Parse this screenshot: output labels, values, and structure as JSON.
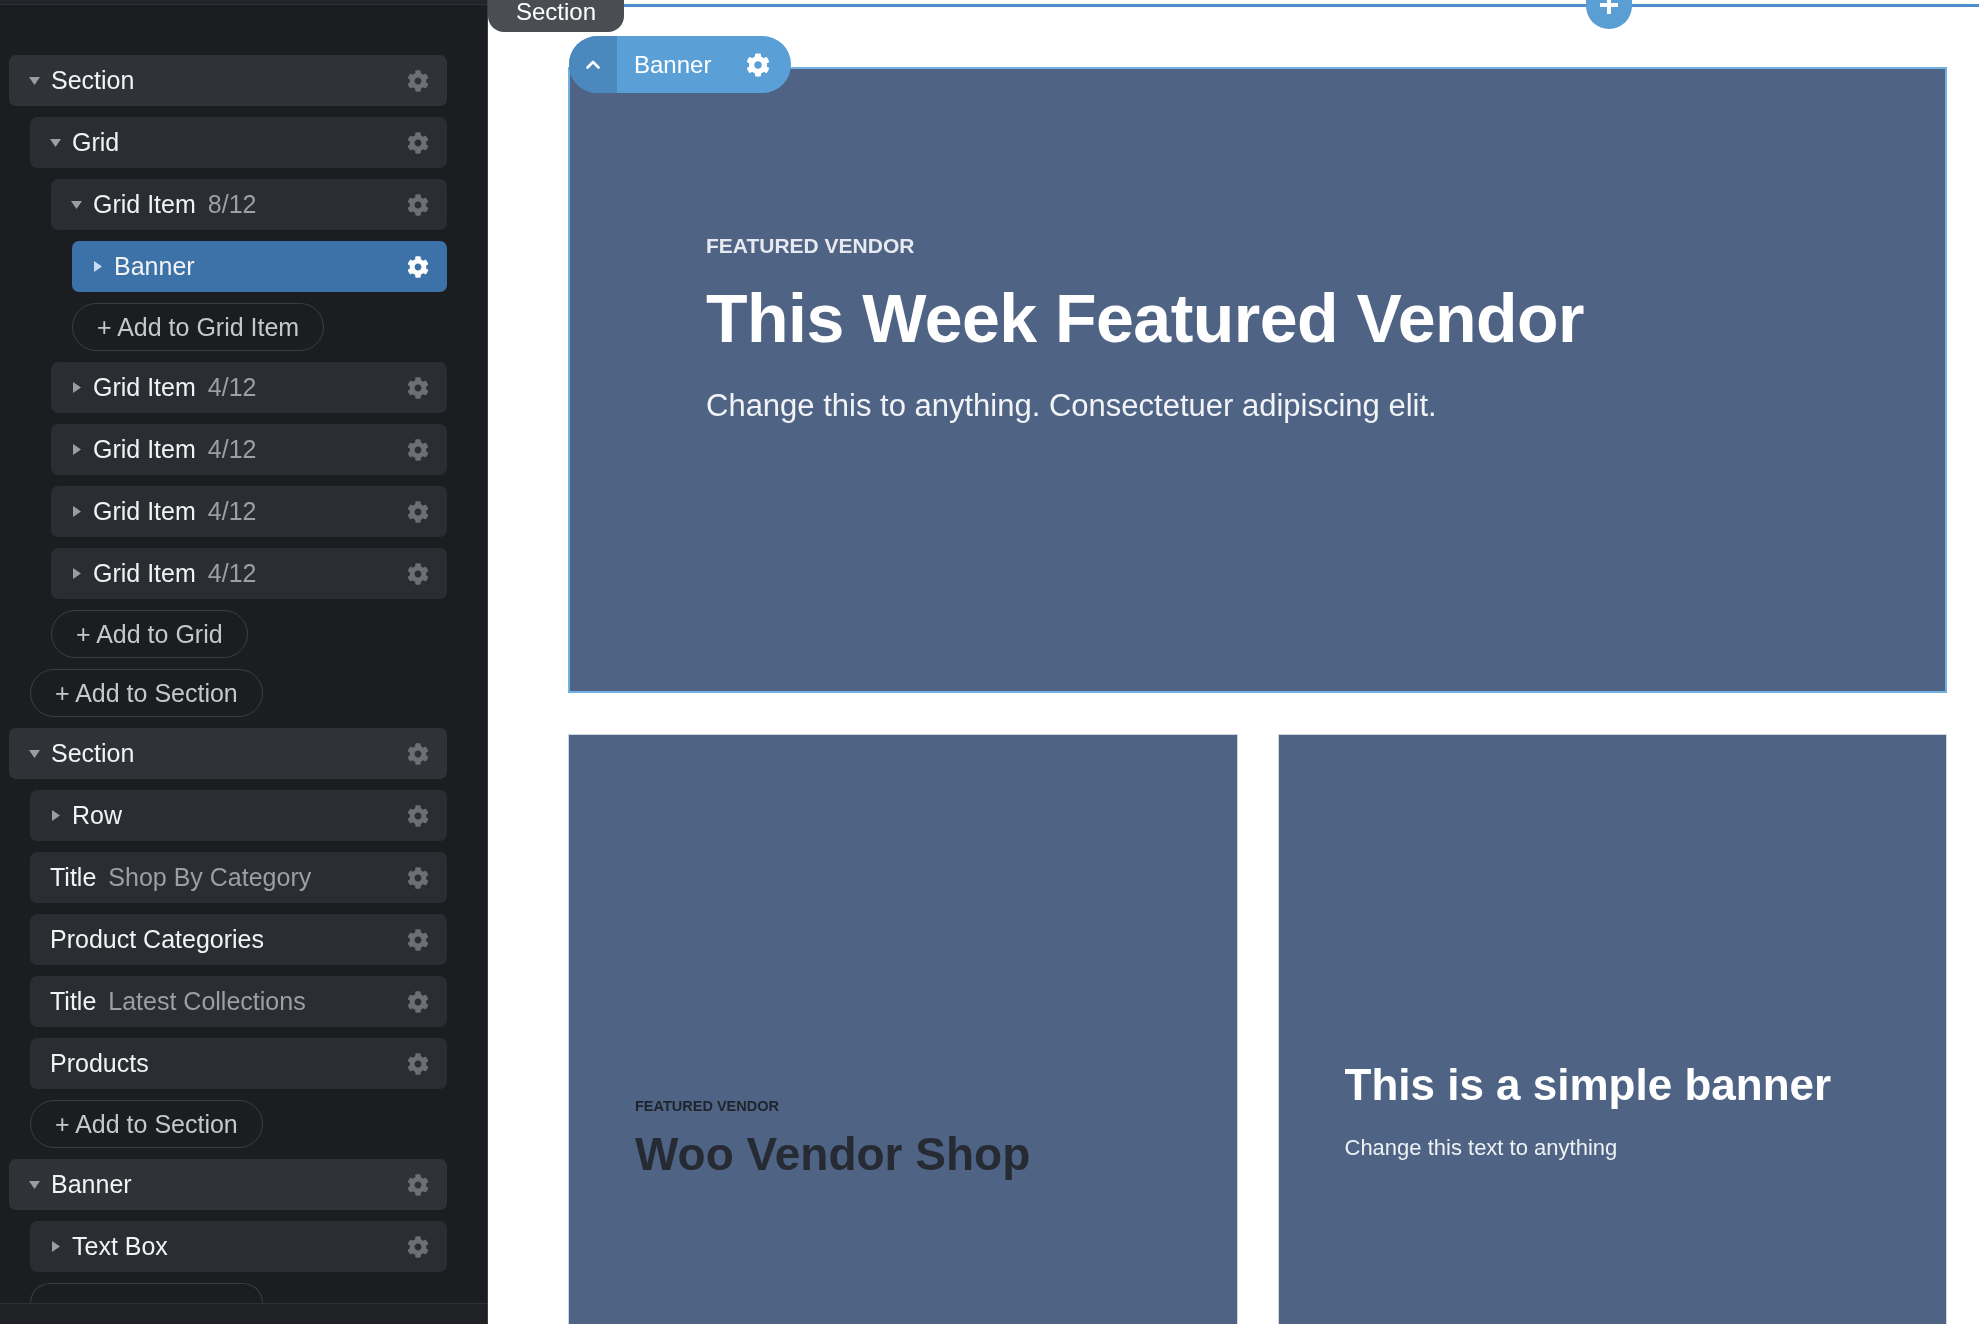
{
  "sidebar": {
    "tree": [
      {
        "kind": "node",
        "label": "Section",
        "expanded": true,
        "selected": false,
        "children": [
          {
            "kind": "node",
            "label": "Grid",
            "expanded": true,
            "selected": false,
            "children": [
              {
                "kind": "node",
                "label": "Grid Item",
                "detail": "8/12",
                "expanded": true,
                "selected": false,
                "children": [
                  {
                    "kind": "node",
                    "label": "Banner",
                    "expanded": false,
                    "selected": true
                  },
                  {
                    "kind": "add",
                    "label": "+ Add to Grid Item"
                  }
                ]
              },
              {
                "kind": "node",
                "label": "Grid Item",
                "detail": "4/12",
                "expanded": false,
                "selected": false
              },
              {
                "kind": "node",
                "label": "Grid Item",
                "detail": "4/12",
                "expanded": false,
                "selected": false
              },
              {
                "kind": "node",
                "label": "Grid Item",
                "detail": "4/12",
                "expanded": false,
                "selected": false
              },
              {
                "kind": "node",
                "label": "Grid Item",
                "detail": "4/12",
                "expanded": false,
                "selected": false
              },
              {
                "kind": "add",
                "label": "+ Add to Grid"
              }
            ]
          },
          {
            "kind": "add",
            "label": "+ Add to Section"
          }
        ]
      },
      {
        "kind": "node",
        "label": "Section",
        "expanded": true,
        "selected": false,
        "children": [
          {
            "kind": "node",
            "label": "Row",
            "expanded": false,
            "selected": false
          },
          {
            "kind": "leaf",
            "label": "Title",
            "detail": "Shop By Category",
            "selected": false
          },
          {
            "kind": "leaf",
            "label": "Product Categories",
            "selected": false
          },
          {
            "kind": "leaf",
            "label": "Title",
            "detail": "Latest Collections",
            "selected": false
          },
          {
            "kind": "leaf",
            "label": "Products",
            "selected": false
          },
          {
            "kind": "add",
            "label": "+ Add to Section"
          }
        ]
      },
      {
        "kind": "node",
        "label": "Banner",
        "expanded": true,
        "selected": false,
        "children": [
          {
            "kind": "node",
            "label": "Text Box",
            "expanded": false,
            "selected": false
          },
          {
            "kind": "add"
          }
        ]
      }
    ]
  },
  "canvas": {
    "section_tag": {
      "label": "Section"
    },
    "banner": {
      "selected": true,
      "tag": "Banner",
      "eyebrow": "FEATURED VENDOR",
      "title": "This Week Featured Vendor",
      "subtitle": "Change this to anything. Consectetuer adipiscing elit."
    },
    "grid_banners": [
      {
        "kind": "muted",
        "selected": false,
        "eyebrow": "FEATURED VENDOR",
        "title": "Woo Vendor Shop"
      },
      {
        "kind": "plain",
        "selected": false,
        "title": "This is a simple banner",
        "subtitle": "Change this text to anything"
      }
    ]
  }
}
